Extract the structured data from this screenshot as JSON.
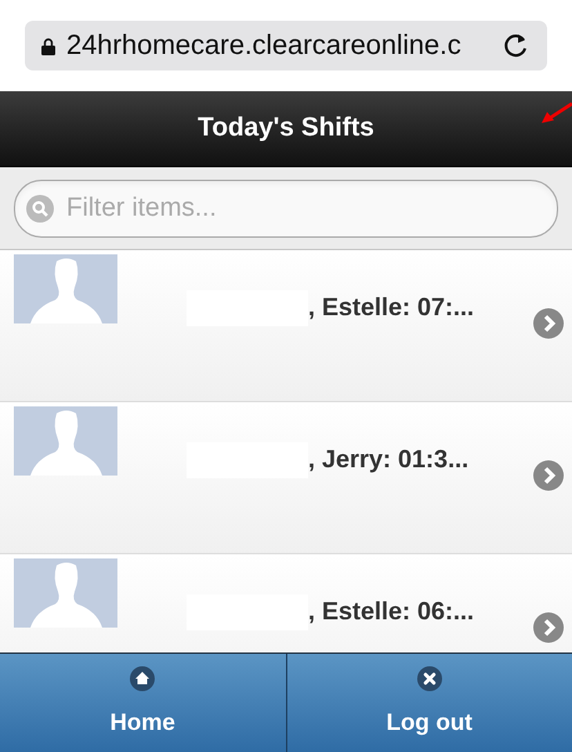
{
  "address_bar": {
    "url": "24hrhomecare.clearcareonline.c"
  },
  "header": {
    "title": "Today's Shifts"
  },
  "filter": {
    "placeholder": "Filter items..."
  },
  "shifts": [
    {
      "label": ", Estelle: 07:..."
    },
    {
      "label": ", Jerry: 01:3..."
    },
    {
      "label": ", Estelle: 06:..."
    }
  ],
  "nav": [
    {
      "label": "Home",
      "kind": "home"
    },
    {
      "label": "Log out",
      "kind": "logout"
    }
  ]
}
